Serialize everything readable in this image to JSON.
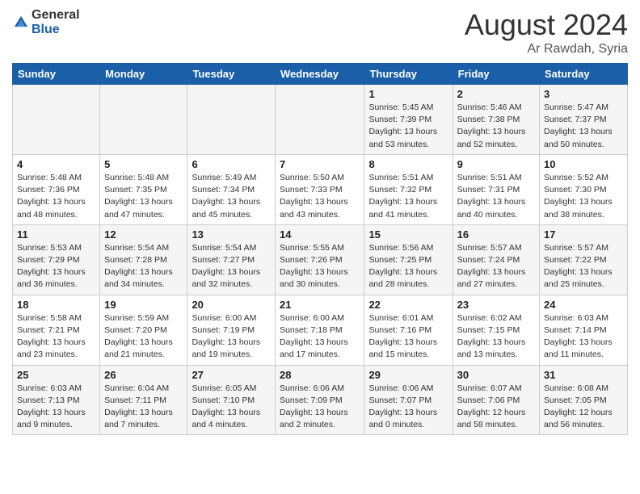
{
  "logo": {
    "line1": "General",
    "line2": "Blue"
  },
  "title": "August 2024",
  "location": "Ar Rawdah, Syria",
  "days_of_week": [
    "Sunday",
    "Monday",
    "Tuesday",
    "Wednesday",
    "Thursday",
    "Friday",
    "Saturday"
  ],
  "weeks": [
    [
      {
        "day": "",
        "info": ""
      },
      {
        "day": "",
        "info": ""
      },
      {
        "day": "",
        "info": ""
      },
      {
        "day": "",
        "info": ""
      },
      {
        "day": "1",
        "sunrise": "5:45 AM",
        "sunset": "7:39 PM",
        "daylight": "13 hours and 53 minutes."
      },
      {
        "day": "2",
        "sunrise": "5:46 AM",
        "sunset": "7:38 PM",
        "daylight": "13 hours and 52 minutes."
      },
      {
        "day": "3",
        "sunrise": "5:47 AM",
        "sunset": "7:37 PM",
        "daylight": "13 hours and 50 minutes."
      }
    ],
    [
      {
        "day": "4",
        "sunrise": "5:48 AM",
        "sunset": "7:36 PM",
        "daylight": "13 hours and 48 minutes."
      },
      {
        "day": "5",
        "sunrise": "5:48 AM",
        "sunset": "7:35 PM",
        "daylight": "13 hours and 47 minutes."
      },
      {
        "day": "6",
        "sunrise": "5:49 AM",
        "sunset": "7:34 PM",
        "daylight": "13 hours and 45 minutes."
      },
      {
        "day": "7",
        "sunrise": "5:50 AM",
        "sunset": "7:33 PM",
        "daylight": "13 hours and 43 minutes."
      },
      {
        "day": "8",
        "sunrise": "5:51 AM",
        "sunset": "7:32 PM",
        "daylight": "13 hours and 41 minutes."
      },
      {
        "day": "9",
        "sunrise": "5:51 AM",
        "sunset": "7:31 PM",
        "daylight": "13 hours and 40 minutes."
      },
      {
        "day": "10",
        "sunrise": "5:52 AM",
        "sunset": "7:30 PM",
        "daylight": "13 hours and 38 minutes."
      }
    ],
    [
      {
        "day": "11",
        "sunrise": "5:53 AM",
        "sunset": "7:29 PM",
        "daylight": "13 hours and 36 minutes."
      },
      {
        "day": "12",
        "sunrise": "5:54 AM",
        "sunset": "7:28 PM",
        "daylight": "13 hours and 34 minutes."
      },
      {
        "day": "13",
        "sunrise": "5:54 AM",
        "sunset": "7:27 PM",
        "daylight": "13 hours and 32 minutes."
      },
      {
        "day": "14",
        "sunrise": "5:55 AM",
        "sunset": "7:26 PM",
        "daylight": "13 hours and 30 minutes."
      },
      {
        "day": "15",
        "sunrise": "5:56 AM",
        "sunset": "7:25 PM",
        "daylight": "13 hours and 28 minutes."
      },
      {
        "day": "16",
        "sunrise": "5:57 AM",
        "sunset": "7:24 PM",
        "daylight": "13 hours and 27 minutes."
      },
      {
        "day": "17",
        "sunrise": "5:57 AM",
        "sunset": "7:22 PM",
        "daylight": "13 hours and 25 minutes."
      }
    ],
    [
      {
        "day": "18",
        "sunrise": "5:58 AM",
        "sunset": "7:21 PM",
        "daylight": "13 hours and 23 minutes."
      },
      {
        "day": "19",
        "sunrise": "5:59 AM",
        "sunset": "7:20 PM",
        "daylight": "13 hours and 21 minutes."
      },
      {
        "day": "20",
        "sunrise": "6:00 AM",
        "sunset": "7:19 PM",
        "daylight": "13 hours and 19 minutes."
      },
      {
        "day": "21",
        "sunrise": "6:00 AM",
        "sunset": "7:18 PM",
        "daylight": "13 hours and 17 minutes."
      },
      {
        "day": "22",
        "sunrise": "6:01 AM",
        "sunset": "7:16 PM",
        "daylight": "13 hours and 15 minutes."
      },
      {
        "day": "23",
        "sunrise": "6:02 AM",
        "sunset": "7:15 PM",
        "daylight": "13 hours and 13 minutes."
      },
      {
        "day": "24",
        "sunrise": "6:03 AM",
        "sunset": "7:14 PM",
        "daylight": "13 hours and 11 minutes."
      }
    ],
    [
      {
        "day": "25",
        "sunrise": "6:03 AM",
        "sunset": "7:13 PM",
        "daylight": "13 hours and 9 minutes."
      },
      {
        "day": "26",
        "sunrise": "6:04 AM",
        "sunset": "7:11 PM",
        "daylight": "13 hours and 7 minutes."
      },
      {
        "day": "27",
        "sunrise": "6:05 AM",
        "sunset": "7:10 PM",
        "daylight": "13 hours and 4 minutes."
      },
      {
        "day": "28",
        "sunrise": "6:06 AM",
        "sunset": "7:09 PM",
        "daylight": "13 hours and 2 minutes."
      },
      {
        "day": "29",
        "sunrise": "6:06 AM",
        "sunset": "7:07 PM",
        "daylight": "13 hours and 0 minutes."
      },
      {
        "day": "30",
        "sunrise": "6:07 AM",
        "sunset": "7:06 PM",
        "daylight": "12 hours and 58 minutes."
      },
      {
        "day": "31",
        "sunrise": "6:08 AM",
        "sunset": "7:05 PM",
        "daylight": "12 hours and 56 minutes."
      }
    ]
  ]
}
